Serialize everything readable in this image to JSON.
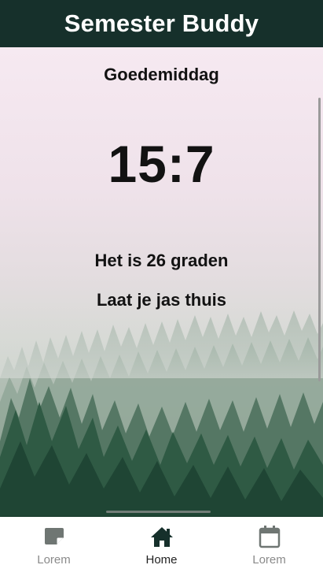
{
  "header": {
    "title": "Semester Buddy"
  },
  "main": {
    "greeting": "Goedemiddag",
    "time": "15:7",
    "temperature_text": "Het is 26 graden",
    "advice_text": "Laat je jas thuis",
    "background_image": "misty-forest"
  },
  "bottom_nav": {
    "items": [
      {
        "label": "Lorem",
        "icon": "note-icon",
        "active": false
      },
      {
        "label": "Home",
        "icon": "home-icon",
        "active": true
      },
      {
        "label": "Lorem",
        "icon": "calendar-icon",
        "active": false
      }
    ]
  },
  "colors": {
    "header_bg": "#16302b",
    "nav_active": "#16302b",
    "nav_inactive": "#6f7673",
    "text": "#121212"
  }
}
